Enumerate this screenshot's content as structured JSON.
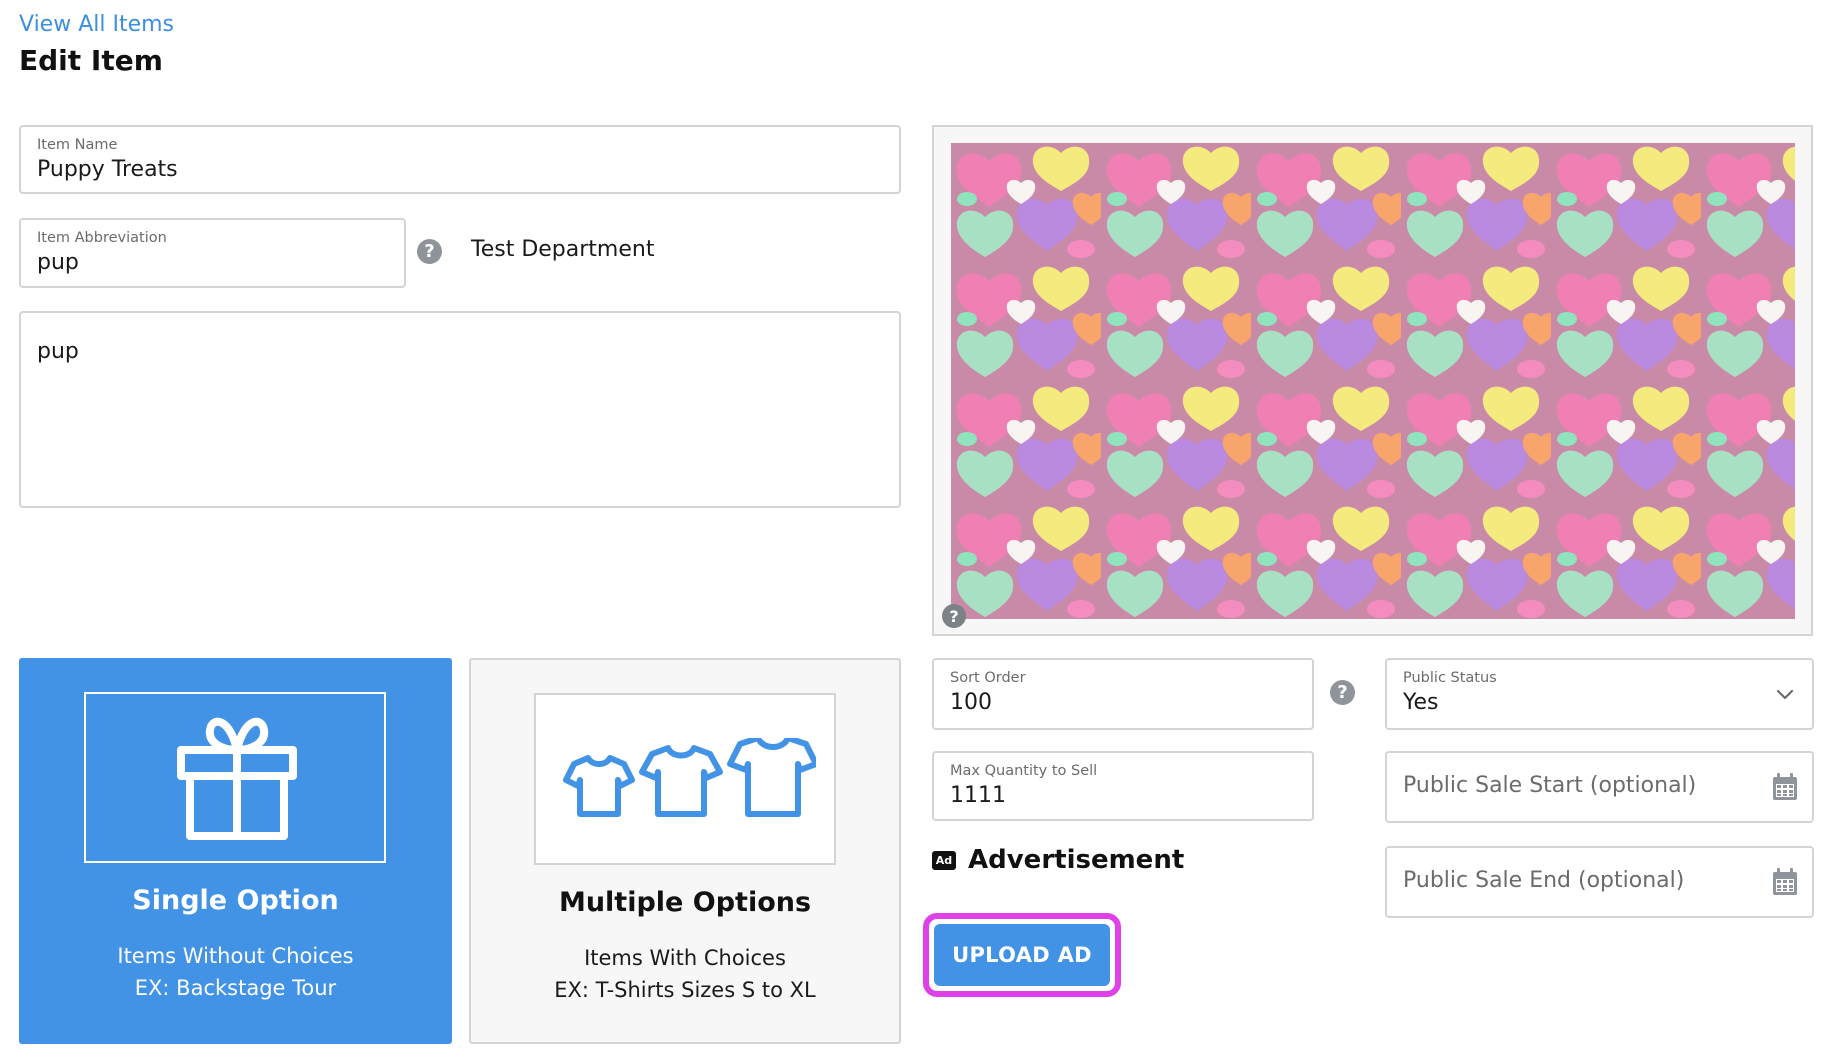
{
  "nav": {
    "view_all_label": "View All Items"
  },
  "page": {
    "title": "Edit Item"
  },
  "form": {
    "item_name": {
      "label": "Item Name",
      "value": "Puppy Treats"
    },
    "item_abbreviation": {
      "label": "Item Abbreviation",
      "value": "pup"
    },
    "department": "Test Department",
    "description": {
      "value": "pup"
    },
    "sort_order": {
      "label": "Sort Order",
      "value": "100"
    },
    "max_quantity": {
      "label": "Max Quantity to Sell",
      "value": "1111"
    },
    "public_status": {
      "label": "Public Status",
      "value": "Yes"
    },
    "public_sale_start": {
      "placeholder": "Public Sale Start (optional)"
    },
    "public_sale_end": {
      "placeholder": "Public Sale End (optional)"
    }
  },
  "image": {
    "icon": "help-icon"
  },
  "option_cards": [
    {
      "title": "Single Option",
      "line1": "Items Without Choices",
      "line2": "EX: Backstage Tour",
      "icon": "gift-icon",
      "selected": true
    },
    {
      "title": "Multiple Options",
      "line1": "Items With Choices",
      "line2": "EX: T-Shirts Sizes S to XL",
      "icon": "tshirts-icon",
      "selected": false
    }
  ],
  "advertisement": {
    "badge": "Ad",
    "heading": "Advertisement",
    "upload_label": "UPLOAD AD"
  },
  "colors": {
    "accent": "#4293e6",
    "link": "#3d8fe0",
    "highlight": "#e040e8",
    "border": "#d4d4d4"
  }
}
